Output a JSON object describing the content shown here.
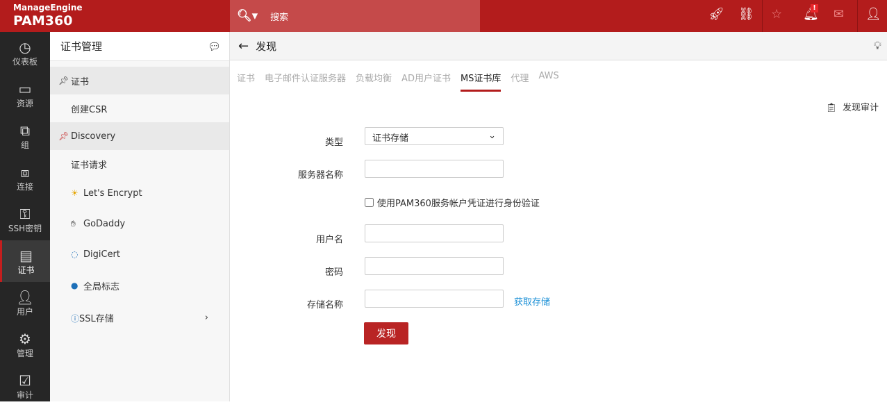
{
  "header": {
    "brand": "ManageEngine",
    "product": "PAM360",
    "search_placeholder": "搜索",
    "alert_badge": "!"
  },
  "nav": [
    {
      "label": "仪表板",
      "icon": "dashboard-icon"
    },
    {
      "label": "资源",
      "icon": "monitor-icon"
    },
    {
      "label": "组",
      "icon": "group-icon"
    },
    {
      "label": "连接",
      "icon": "connection-icon"
    },
    {
      "label": "SSH密钥",
      "icon": "key-icon"
    },
    {
      "label": "证书",
      "icon": "certificate-icon"
    },
    {
      "label": "用户",
      "icon": "user-icon"
    },
    {
      "label": "管理",
      "icon": "gear-icon"
    },
    {
      "label": "审计",
      "icon": "audit-icon"
    }
  ],
  "sidebar": {
    "title": "证书管理",
    "items": [
      {
        "label": "证书"
      },
      {
        "label": "创建CSR"
      },
      {
        "label": "Discovery"
      },
      {
        "label": "证书请求"
      },
      {
        "label": "Let's Encrypt"
      },
      {
        "label": "GoDaddy"
      },
      {
        "label": "DigiCert"
      },
      {
        "label": "全局标志"
      },
      {
        "label": "SSL存储"
      }
    ]
  },
  "main": {
    "title": "发现",
    "tabs": [
      "证书",
      "电子邮件认证服务器",
      "负载均衡",
      "AD用户证书",
      "MS证书库",
      "代理",
      "AWS"
    ],
    "audit_label": "发现审计",
    "form": {
      "type_label": "类型",
      "type_value": "证书存储",
      "server_label": "服务器名称",
      "checkbox_label": "使用PAM360服务帐户凭证进行身份验证",
      "user_label": "用户名",
      "password_label": "密码",
      "store_label": "存储名称",
      "fetch_link": "获取存储",
      "submit": "发现"
    }
  }
}
